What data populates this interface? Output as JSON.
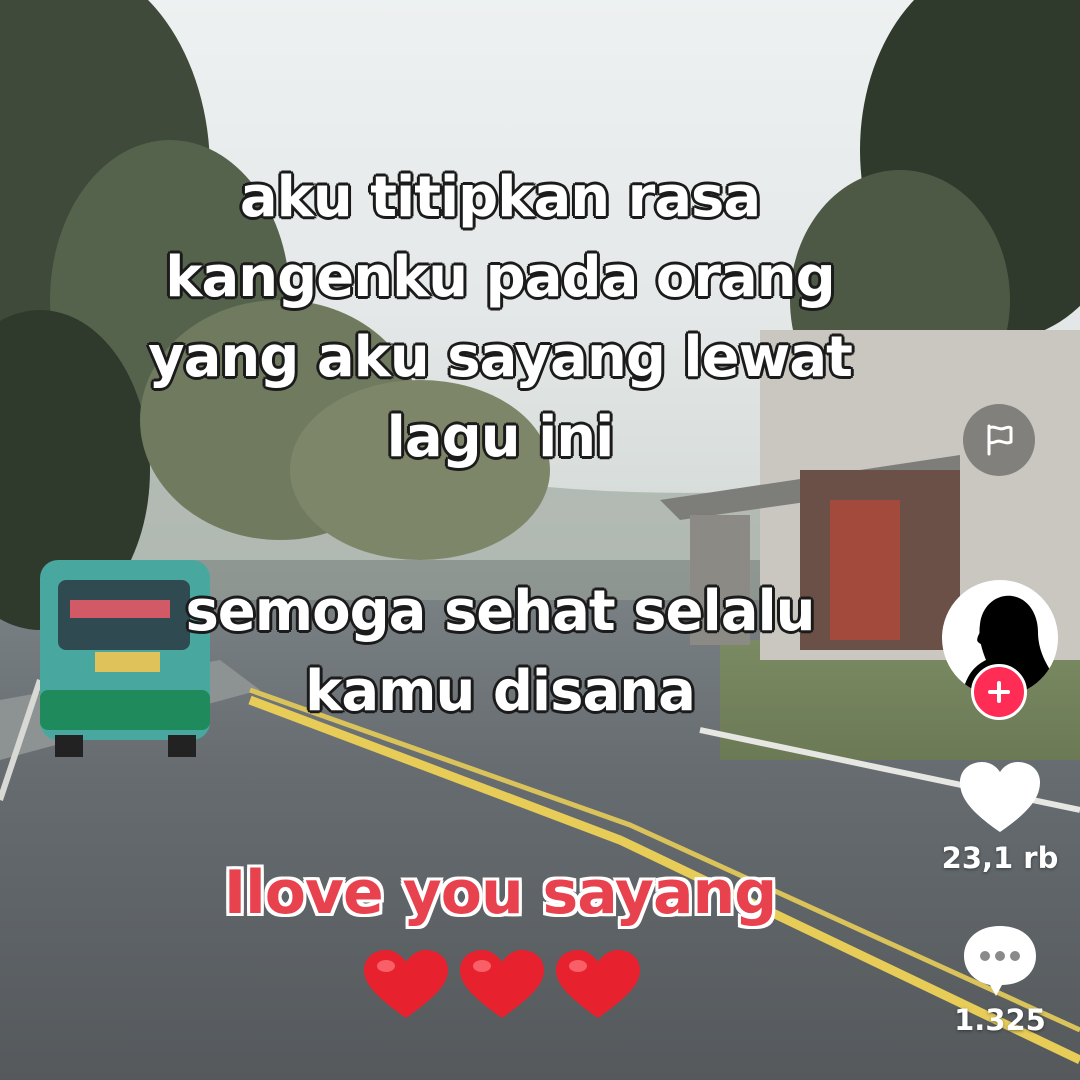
{
  "caption": {
    "lines_top": [
      "aku titipkan rasa",
      "kangenku pada orang",
      "yang aku sayang lewat",
      "lagu ini"
    ],
    "lines_bottom": [
      "semoga sehat selalu",
      "kamu disana"
    ],
    "love_line": "Ilove you sayang",
    "hearts": [
      "red-heart-icon",
      "red-heart-icon",
      "red-heart-icon"
    ]
  },
  "sidebar": {
    "report_icon": "flag-icon",
    "avatar_icon": "profile-avatar",
    "follow_icon": "plus-icon",
    "like": {
      "icon": "heart-icon",
      "count": "23,1 rb"
    },
    "comment": {
      "icon": "comment-bubble-icon",
      "count": "1.325"
    }
  },
  "colors": {
    "caption_text": "#ffffff",
    "love_text": "#e8424e",
    "follow_button": "#ff2c55",
    "heart_emoji": "#e8212e"
  }
}
